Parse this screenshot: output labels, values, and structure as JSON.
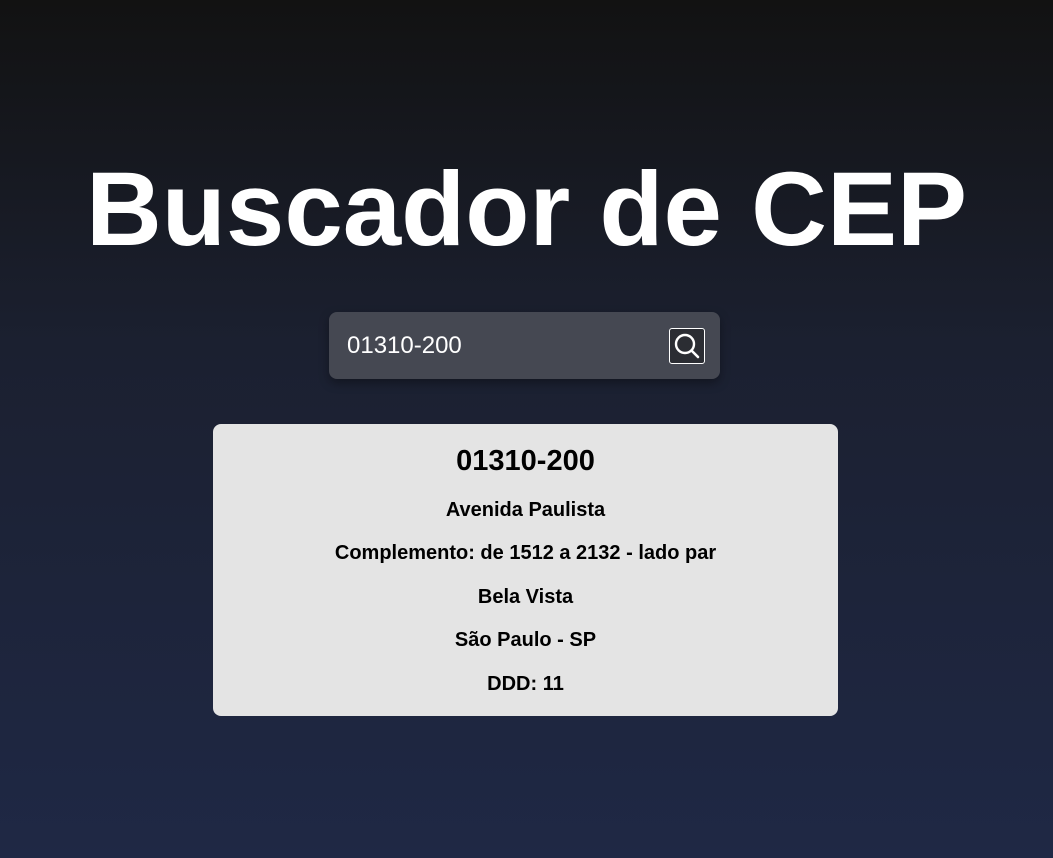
{
  "page": {
    "title": "Buscador de CEP"
  },
  "search": {
    "value": "01310-200",
    "button_icon": "search-icon"
  },
  "result": {
    "cep": "01310-200",
    "logradouro": "Avenida Paulista",
    "complemento": "Complemento: de 1512 a 2132 - lado par",
    "bairro": "Bela Vista",
    "cidade_uf": "São Paulo - SP",
    "ddd": "DDD: 11"
  },
  "colors": {
    "background_top": "#121212",
    "background_bottom": "#1f2845",
    "search_box": "#454852",
    "card": "#e4e4e4",
    "text_light": "#ffffff",
    "text_dark": "#000000"
  }
}
